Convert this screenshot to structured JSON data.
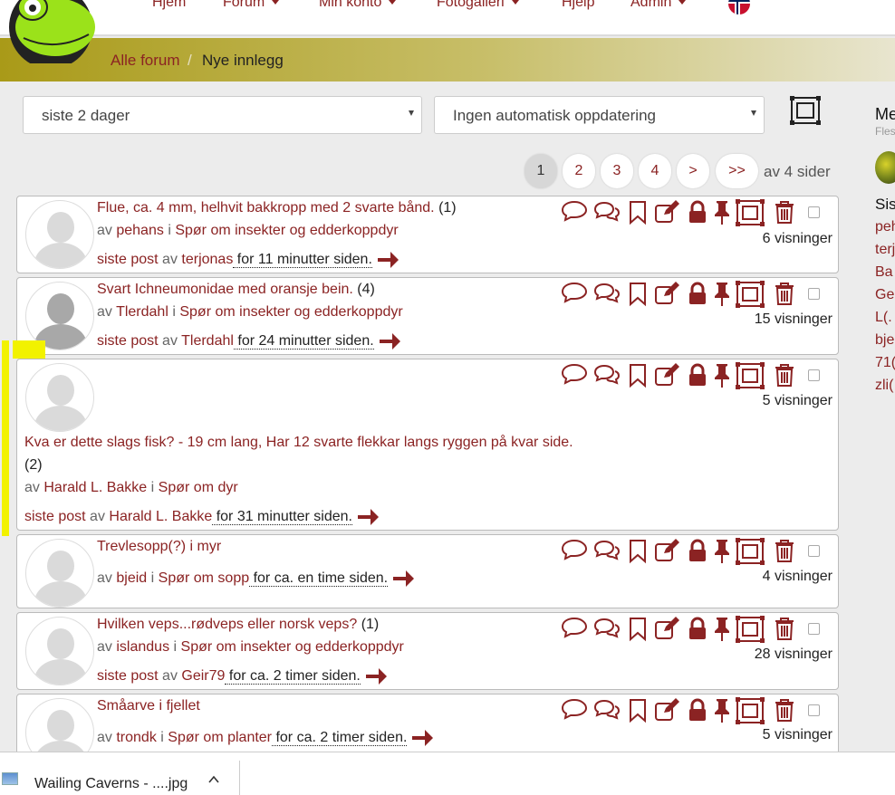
{
  "nav": {
    "items": [
      {
        "label": "Hjem",
        "dropdown": false
      },
      {
        "label": "Forum",
        "dropdown": true
      },
      {
        "label": "Min konto",
        "dropdown": true
      },
      {
        "label": "Fotogalleri",
        "dropdown": true
      },
      {
        "label": "Hjelp",
        "dropdown": false
      },
      {
        "label": "Admin",
        "dropdown": true
      }
    ],
    "flag": "norway-flag-icon"
  },
  "breadcrumb": {
    "home": "Alle forum",
    "separator": "/",
    "current": "Nye innlegg"
  },
  "filters": {
    "period": "siste 2 dager",
    "refresh": "Ingen automatisk oppdatering"
  },
  "pagination": {
    "pages": [
      "1",
      "2",
      "3",
      "4"
    ],
    "next": ">",
    "last": ">>",
    "suffix": "av 4 sider",
    "current": 1
  },
  "sidebar": {
    "heading": "Me",
    "sub": "Fles",
    "section": "Sis",
    "items": [
      "peh",
      "terj",
      "Ba",
      "Ge",
      "L(.",
      "bje",
      "71(",
      "zli("
    ]
  },
  "labels": {
    "by": "av",
    "in": "i",
    "last_post": "siste post",
    "last_post_by": "av"
  },
  "posts": [
    {
      "title": "Flue, ca. 4 mm, helhvit bakkropp med 2 svarte bånd.",
      "count": "(1)",
      "author": "pehans",
      "forum": "Spør om insekter og edderkoppdyr",
      "last_author": "terjonas",
      "time": " for 11 minutter siden.",
      "views": "6 visninger"
    },
    {
      "title": "Svart Ichneumonidae med oransje bein.",
      "count": "(4)",
      "author": "Tlerdahl",
      "forum": "Spør om insekter og edderkoppdyr",
      "last_author": "Tlerdahl",
      "time": " for 24 minutter siden.",
      "views": "15 visninger"
    },
    {
      "title": "Kva er dette slags fisk? - 19 cm lang, Har 12 svarte flekkar langs ryggen på kvar side.",
      "count": "(2)",
      "author": "Harald L. Bakke",
      "forum": "Spør om dyr",
      "last_author": "Harald L. Bakke",
      "time": " for 31 minutter siden.",
      "views": "5 visninger"
    },
    {
      "title": "Trevlesopp(?) i myr",
      "count": "",
      "author": "bjeid",
      "forum": "Spør om sopp",
      "last_author": "",
      "time": " for ca. en time siden.",
      "views": "4 visninger"
    },
    {
      "title": "Hvilken veps...rødveps eller norsk veps?",
      "count": "(1)",
      "author": "islandus",
      "forum": "Spør om insekter og edderkoppdyr",
      "last_author": "Geir79",
      "time": " for ca. 2 timer siden.",
      "views": "28 visninger"
    },
    {
      "title": "Småarve i fjellet",
      "count": "",
      "author": "trondk",
      "forum": "Spør om planter",
      "last_author": "",
      "time": " for ca. 2 timer siden.",
      "views": "5 visninger"
    }
  ],
  "downloads": {
    "file": "Wailing Caverns - ....jpg"
  },
  "colors": {
    "accent": "#8b2323",
    "crumb_gradient_start": "#a99a18",
    "highlight": "#f2f200"
  }
}
